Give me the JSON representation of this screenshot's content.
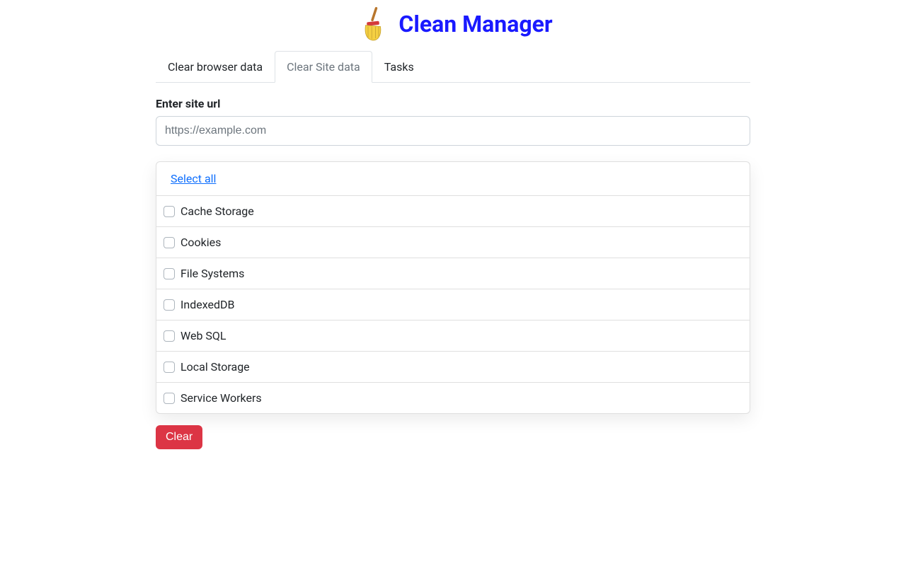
{
  "header": {
    "title": "Clean Manager",
    "icon": "broom-icon"
  },
  "tabs": [
    {
      "label": "Clear browser data",
      "active": false
    },
    {
      "label": "Clear Site data",
      "active": true
    },
    {
      "label": "Tasks",
      "active": false
    }
  ],
  "site": {
    "url_label": "Enter site url",
    "url_placeholder": "https://example.com",
    "url_value": "",
    "select_all_label": "Select all",
    "options": [
      "Cache Storage",
      "Cookies",
      "File Systems",
      "IndexedDB",
      "Web SQL",
      "Local Storage",
      "Service Workers"
    ],
    "clear_button_label": "Clear"
  }
}
